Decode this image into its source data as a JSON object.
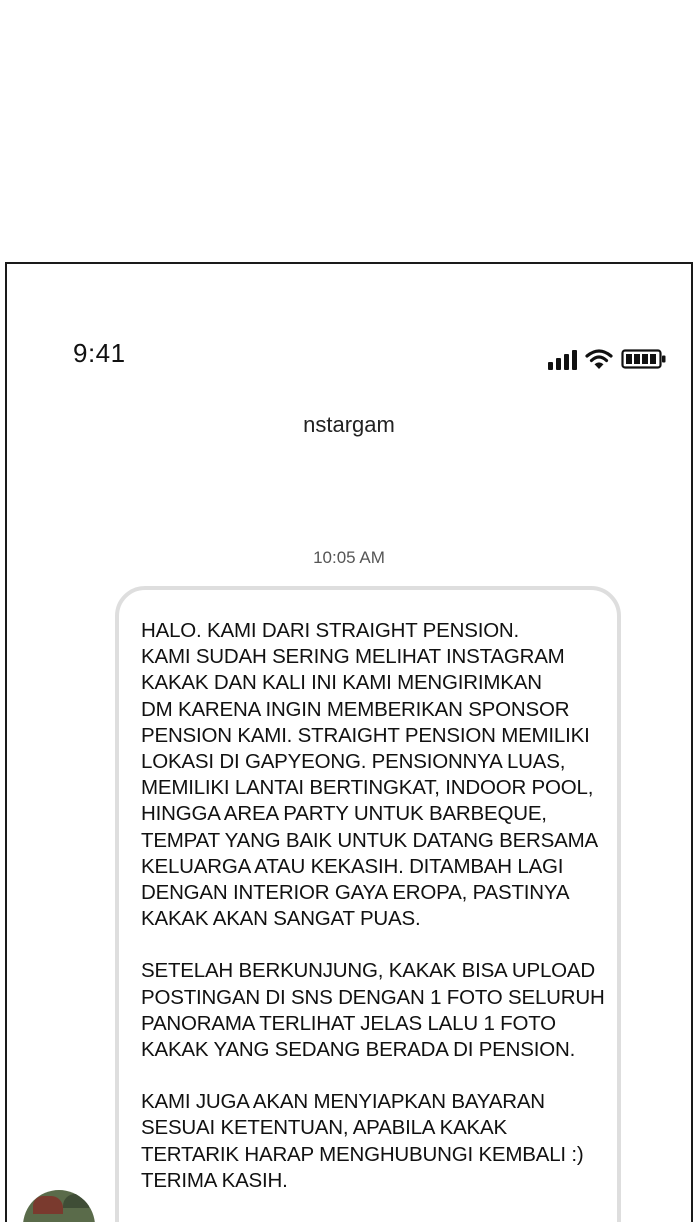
{
  "status_bar": {
    "time": "9:41",
    "icons": [
      "cellular-signal-icon",
      "wifi-icon",
      "battery-icon"
    ]
  },
  "header": {
    "title": "nstargam"
  },
  "conversation": {
    "timestamp": "10:05 AM",
    "message": {
      "paragraphs": [
        "HALO. KAMI DARI STRAIGHT PENSION.\nKAMI SUDAH SERING MELIHAT INSTAGRAM\nKAKAK DAN KALI INI KAMI MENGIRIMKAN\nDM KARENA INGIN MEMBERIKAN SPONSOR\nPENSION KAMI. STRAIGHT PENSION MEMILIKI\nLOKASI DI GAPYEONG. PENSIONNYA LUAS,\nMEMILIKI LANTAI BERTINGKAT, INDOOR POOL,\nHINGGA AREA PARTY UNTUK BARBEQUE,\nTEMPAT YANG BAIK UNTUK DATANG BERSAMA\nKELUARGA ATAU KEKASIH. DITAMBAH LAGI\nDENGAN INTERIOR GAYA EROPA, PASTINYA\nKAKAK AKAN SANGAT PUAS.",
        "SETELAH BERKUNJUNG, KAKAK BISA UPLOAD\nPOSTINGAN DI SNS DENGAN 1 FOTO  SELURUH\nPANORAMA TERLIHAT JELAS LALU 1 FOTO\nKAKAK YANG SEDANG BERADA DI PENSION.",
        "KAMI JUGA AKAN MENYIAPKAN BAYARAN\nSESUAI KETENTUAN, APABILA KAKAK\nTERTARIK HARAP MENGHUBUNGI KEMBALI :)\nTERIMA KASIH."
      ]
    }
  },
  "colors": {
    "frame_border": "#1a1a1a",
    "bubble_border": "#dedede",
    "text": "#111111",
    "timestamp_text": "#555555"
  }
}
